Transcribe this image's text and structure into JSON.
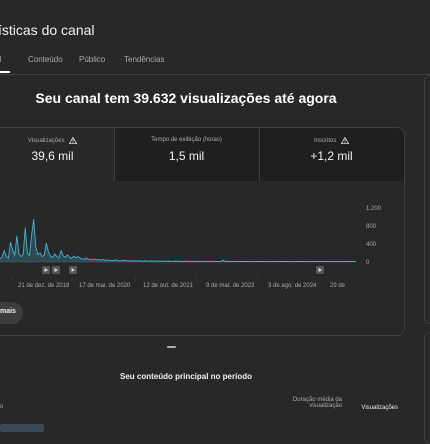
{
  "page": {
    "title": "ísticas do canal",
    "tabs": [
      {
        "label": "ral",
        "active": true
      },
      {
        "label": "Conteúdo",
        "active": false
      },
      {
        "label": "Público",
        "active": false
      },
      {
        "label": "Tendências",
        "active": false
      }
    ],
    "headline": "Seu canal tem 39.632 visualizações até agora"
  },
  "metrics": [
    {
      "label": "Visualizações",
      "value": "39,6 mil",
      "warning": true,
      "selected": true
    },
    {
      "label": "Tempo de exibição (horas)",
      "value": "1,5 mil",
      "warning": false,
      "selected": false
    },
    {
      "label": "Inscritos",
      "value": "+1,2 mil",
      "warning": true,
      "selected": false
    }
  ],
  "see_more_label": "mais",
  "chart_data": {
    "type": "line",
    "color": "#41b4d2",
    "y_ticks": [
      "0",
      "400",
      "800",
      "1.200"
    ],
    "ylim": [
      0,
      1200
    ],
    "x_ticks": [
      "21 de dez. de 2018",
      "17 de mai. de 2020",
      "12 de out. de 2021",
      "9 de mar. de 2023",
      "3 de ago. de 2024",
      "29 de"
    ],
    "series": [
      {
        "values": [
          60,
          110,
          250,
          120,
          90,
          440,
          260,
          150,
          580,
          180,
          120,
          170,
          760,
          210,
          140,
          600,
          950,
          330,
          170,
          200,
          120,
          150,
          420,
          220,
          130,
          100,
          180,
          120,
          90,
          250,
          140,
          100,
          160,
          110,
          80,
          130,
          95,
          120,
          85,
          70,
          60,
          90,
          55,
          65,
          50,
          70,
          45,
          55,
          40,
          60,
          35,
          45,
          40,
          30,
          35,
          50,
          30,
          25,
          30,
          40,
          28,
          25,
          22,
          30,
          25,
          20,
          28,
          22,
          18,
          25,
          20,
          18,
          22,
          20,
          16,
          24,
          18,
          20,
          15,
          18,
          22,
          16,
          14,
          18,
          20,
          15,
          14,
          16,
          18,
          15,
          12,
          14,
          16,
          14,
          12,
          15,
          14,
          12,
          13,
          15,
          12,
          13,
          14,
          12,
          11,
          13,
          40,
          12,
          14,
          11,
          12,
          13,
          11,
          12,
          10,
          13,
          11,
          12,
          10,
          11,
          12,
          10,
          11,
          12,
          10,
          11,
          12,
          10,
          11,
          10,
          12,
          11,
          10,
          12,
          11,
          10,
          11,
          12,
          10,
          11,
          10,
          12,
          11,
          10,
          11,
          12,
          10,
          11,
          10,
          11,
          12,
          10,
          11,
          10,
          12,
          11,
          10,
          11,
          10,
          12,
          11,
          10,
          11,
          10,
          12,
          11,
          10,
          11,
          10,
          12
        ]
      }
    ]
  },
  "chart_icons": [
    "play-icon",
    "play-icon",
    "play-icon",
    "play-icon"
  ],
  "top_content": {
    "title": "Seu conteúdo principal no período",
    "columns": [
      {
        "label": "Duração média da visualização",
        "selected": false
      },
      {
        "label": "Visualizações",
        "selected": true
      }
    ],
    "partial_label": "o"
  }
}
